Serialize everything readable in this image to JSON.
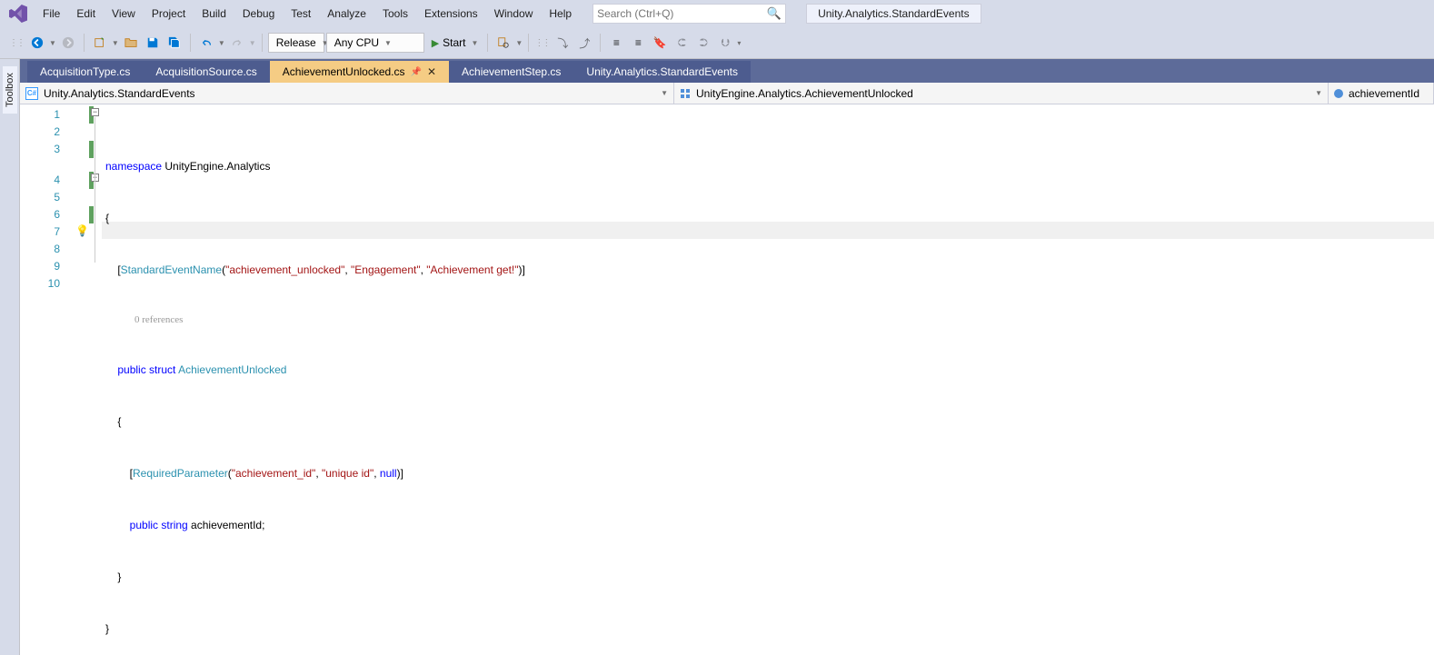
{
  "menu": [
    "File",
    "Edit",
    "View",
    "Project",
    "Build",
    "Debug",
    "Test",
    "Analyze",
    "Tools",
    "Extensions",
    "Window",
    "Help"
  ],
  "search_placeholder": "Search (Ctrl+Q)",
  "solution_name": "Unity.Analytics.StandardEvents",
  "toolbar": {
    "config": "Release",
    "platform": "Any CPU",
    "start": "Start"
  },
  "tabs": [
    {
      "label": "AcquisitionType.cs",
      "active": false
    },
    {
      "label": "AcquisitionSource.cs",
      "active": false
    },
    {
      "label": "AchievementUnlocked.cs",
      "active": true,
      "pinned": true,
      "closable": true
    },
    {
      "label": "AchievementStep.cs",
      "active": false
    },
    {
      "label": "Unity.Analytics.StandardEvents",
      "active": false
    }
  ],
  "nav": {
    "scope": "Unity.Analytics.StandardEvents",
    "type": "UnityEngine.Analytics.AchievementUnlocked",
    "member": "achievementId"
  },
  "toolbox_label": "Toolbox",
  "codelens": "0 references",
  "code": {
    "l1a": "namespace",
    "l1b": " UnityEngine.Analytics",
    "l2": "{",
    "l3a": "    [",
    "l3b": "StandardEventName",
    "l3c": "(",
    "l3d": "\"achievement_unlocked\"",
    "l3e": ", ",
    "l3f": "\"Engagement\"",
    "l3g": ", ",
    "l3h": "\"Achievement get!\"",
    "l3i": ")]",
    "l4a": "    ",
    "l4b": "public",
    "l4c": " ",
    "l4d": "struct",
    "l4e": " ",
    "l4f": "AchievementUnlocked",
    "l5": "    {",
    "l6a": "        [",
    "l6b": "RequiredParameter",
    "l6c": "(",
    "l6d": "\"achievement_id\"",
    "l6e": ", ",
    "l6f": "\"unique id\"",
    "l6g": ", ",
    "l6h": "null",
    "l6i": ")]",
    "l7a": "        ",
    "l7b": "public",
    "l7c": " ",
    "l7d": "string",
    "l7e": " achievementId;",
    "l8": "    }",
    "l9": "}",
    "lines": [
      "1",
      "2",
      "3",
      "4",
      "5",
      "6",
      "7",
      "8",
      "9",
      "10"
    ]
  }
}
